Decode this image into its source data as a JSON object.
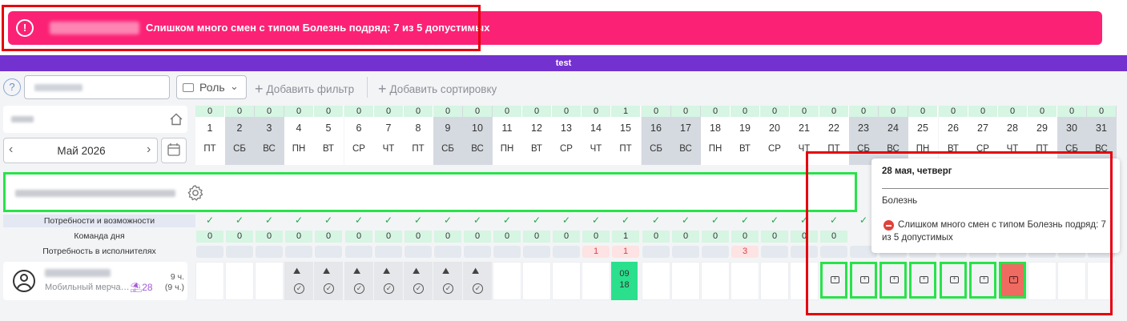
{
  "alert": {
    "message": "Слишком много смен с типом Болезнь подряд: 7 из 5 допустимых",
    "icon": "alert-circle-icon",
    "color": "#fb2276"
  },
  "title": "test",
  "toolbar": {
    "help_label": "?",
    "role_label": "Роль",
    "add_filter_label": "Добавить фильтр",
    "add_sort_label": "Добавить сортировку"
  },
  "calendar": {
    "month_label": "Май 2026",
    "prev_label": "‹",
    "next_label": "›",
    "days": [
      {
        "num": "1",
        "name": "ПТ",
        "count": "0",
        "weekend": false
      },
      {
        "num": "2",
        "name": "СБ",
        "count": "0",
        "weekend": true
      },
      {
        "num": "3",
        "name": "ВС",
        "count": "0",
        "weekend": true
      },
      {
        "num": "4",
        "name": "ПН",
        "count": "0",
        "weekend": false
      },
      {
        "num": "5",
        "name": "ВТ",
        "count": "0",
        "weekend": false
      },
      {
        "num": "6",
        "name": "СР",
        "count": "0",
        "weekend": false
      },
      {
        "num": "7",
        "name": "ЧТ",
        "count": "0",
        "weekend": false
      },
      {
        "num": "8",
        "name": "ПТ",
        "count": "0",
        "weekend": false
      },
      {
        "num": "9",
        "name": "СБ",
        "count": "0",
        "weekend": true
      },
      {
        "num": "10",
        "name": "ВС",
        "count": "0",
        "weekend": true
      },
      {
        "num": "11",
        "name": "ПН",
        "count": "0",
        "weekend": false
      },
      {
        "num": "12",
        "name": "ВТ",
        "count": "0",
        "weekend": false
      },
      {
        "num": "13",
        "name": "СР",
        "count": "0",
        "weekend": false
      },
      {
        "num": "14",
        "name": "ЧТ",
        "count": "0",
        "weekend": false
      },
      {
        "num": "15",
        "name": "ПТ",
        "count": "1",
        "weekend": false
      },
      {
        "num": "16",
        "name": "СБ",
        "count": "0",
        "weekend": true
      },
      {
        "num": "17",
        "name": "ВС",
        "count": "0",
        "weekend": true
      },
      {
        "num": "18",
        "name": "ПН",
        "count": "0",
        "weekend": false
      },
      {
        "num": "19",
        "name": "ВТ",
        "count": "0",
        "weekend": false
      },
      {
        "num": "20",
        "name": "СР",
        "count": "0",
        "weekend": false
      },
      {
        "num": "21",
        "name": "ЧТ",
        "count": "0",
        "weekend": false
      },
      {
        "num": "22",
        "name": "ПТ",
        "count": "0",
        "weekend": false
      },
      {
        "num": "23",
        "name": "СБ",
        "count": "0",
        "weekend": true
      },
      {
        "num": "24",
        "name": "ВС",
        "count": "0",
        "weekend": true
      },
      {
        "num": "25",
        "name": "ПН",
        "count": "0",
        "weekend": false
      },
      {
        "num": "26",
        "name": "ВТ",
        "count": "0",
        "weekend": false
      },
      {
        "num": "27",
        "name": "СР",
        "count": "0",
        "weekend": false
      },
      {
        "num": "28",
        "name": "ЧТ",
        "count": "0",
        "weekend": false
      },
      {
        "num": "29",
        "name": "ПТ",
        "count": "0",
        "weekend": false
      },
      {
        "num": "30",
        "name": "СБ",
        "count": "0",
        "weekend": true
      },
      {
        "num": "31",
        "name": "ВС",
        "count": "0",
        "weekend": true
      }
    ]
  },
  "stats": {
    "labels": [
      "Потребности и возможности",
      "Команда дня",
      "Потребность в исполнителях"
    ],
    "team_of_day": [
      "0",
      "0",
      "0",
      "0",
      "0",
      "0",
      "0",
      "0",
      "0",
      "0",
      "0",
      "0",
      "0",
      "0",
      "1",
      "0",
      "0",
      "0",
      "0",
      "0",
      "0",
      "0"
    ],
    "needs": [
      "",
      "",
      "",
      "",
      "",
      "",
      "",
      "",
      "",
      "",
      "",
      "",
      "",
      "1",
      "1",
      "",
      "",
      "",
      "3",
      "",
      "",
      ""
    ]
  },
  "employee": {
    "role": "Мобильный мерча…",
    "badge": "28",
    "hours": "9 ч.",
    "hours_sub": "(9 ч.)",
    "shift_time_start": "09",
    "shift_time_end": "18"
  },
  "tooltip": {
    "date": "28 мая, четверг",
    "shift_type": "Болезнь",
    "warning": "Слишком много смен с типом Болезнь подряд: 7 из 5 допустимых"
  }
}
